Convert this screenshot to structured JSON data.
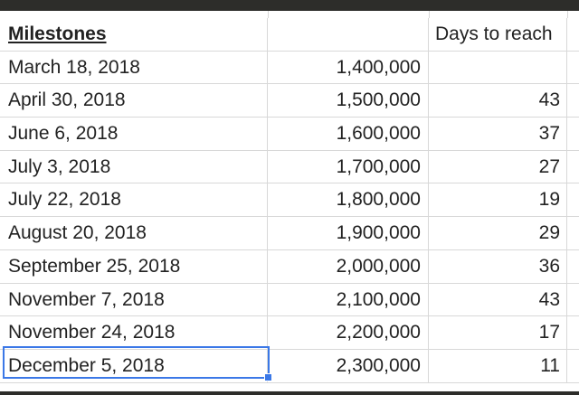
{
  "table": {
    "headers": [
      "Milestones",
      "",
      "Days to reach"
    ],
    "rows": [
      {
        "date": "March 18, 2018",
        "value": "1,400,000",
        "days": ""
      },
      {
        "date": "April 30, 2018",
        "value": "1,500,000",
        "days": "43"
      },
      {
        "date": "June 6, 2018",
        "value": "1,600,000",
        "days": "37"
      },
      {
        "date": "July 3, 2018",
        "value": "1,700,000",
        "days": "27"
      },
      {
        "date": "July 22, 2018",
        "value": "1,800,000",
        "days": "19"
      },
      {
        "date": "August 20, 2018",
        "value": "1,900,000",
        "days": "29"
      },
      {
        "date": "September 25, 2018",
        "value": "2,000,000",
        "days": "36"
      },
      {
        "date": "November 7, 2018",
        "value": "2,100,000",
        "days": "43"
      },
      {
        "date": "November 24, 2018",
        "value": "2,200,000",
        "days": "17"
      },
      {
        "date": "December 5, 2018",
        "value": "2,300,000",
        "days": "11"
      }
    ]
  },
  "colors": {
    "selection_border": "#3b78e7",
    "gridline": "#d8d8d8",
    "frame": "#2d2d2a"
  }
}
